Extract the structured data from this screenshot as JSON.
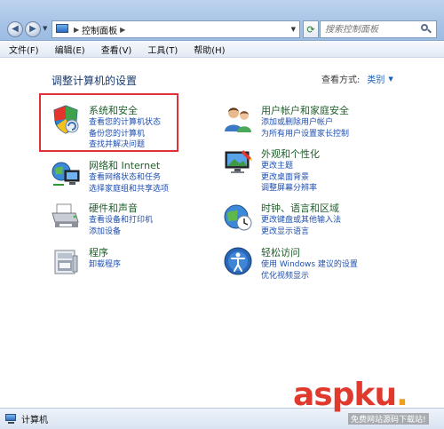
{
  "address_bar": {
    "breadcrumb": "控制面板",
    "search_placeholder": "搜索控制面板"
  },
  "menu": [
    "文件(F)",
    "编辑(E)",
    "查看(V)",
    "工具(T)",
    "帮助(H)"
  ],
  "content": {
    "title": "调整计算机的设置",
    "view_by_label": "查看方式:",
    "view_by_value": "类别"
  },
  "categories": {
    "system_security": {
      "title": "系统和安全",
      "links": [
        "查看您的计算机状态",
        "备份您的计算机",
        "查找并解决问题"
      ]
    },
    "network": {
      "title": "网络和 Internet",
      "links": [
        "查看网络状态和任务",
        "选择家庭组和共享选项"
      ]
    },
    "hardware": {
      "title": "硬件和声音",
      "links": [
        "查看设备和打印机",
        "添加设备"
      ]
    },
    "programs": {
      "title": "程序",
      "links": [
        "卸载程序"
      ]
    },
    "user_accounts": {
      "title": "用户帐户和家庭安全",
      "links": [
        "添加或删除用户帐户",
        "为所有用户设置家长控制"
      ]
    },
    "appearance": {
      "title": "外观和个性化",
      "links": [
        "更改主题",
        "更改桌面背景",
        "调整屏幕分辨率"
      ]
    },
    "clock": {
      "title": "时钟、语言和区域",
      "links": [
        "更改键盘或其他输入法",
        "更改显示语言"
      ]
    },
    "ease": {
      "title": "轻松访问",
      "links": [
        "使用 Windows 建议的设置",
        "优化视频显示"
      ]
    }
  },
  "status_bar": {
    "text": "计算机"
  },
  "watermark": {
    "logo_asp": "asp",
    "logo_ku": "ku",
    "logo_dot": ".",
    "subtitle": "免费网站源码下载站!"
  },
  "colors": {
    "category_title": "#1e5e2a",
    "link": "#1f4fb0",
    "highlight": "#e0303a"
  }
}
